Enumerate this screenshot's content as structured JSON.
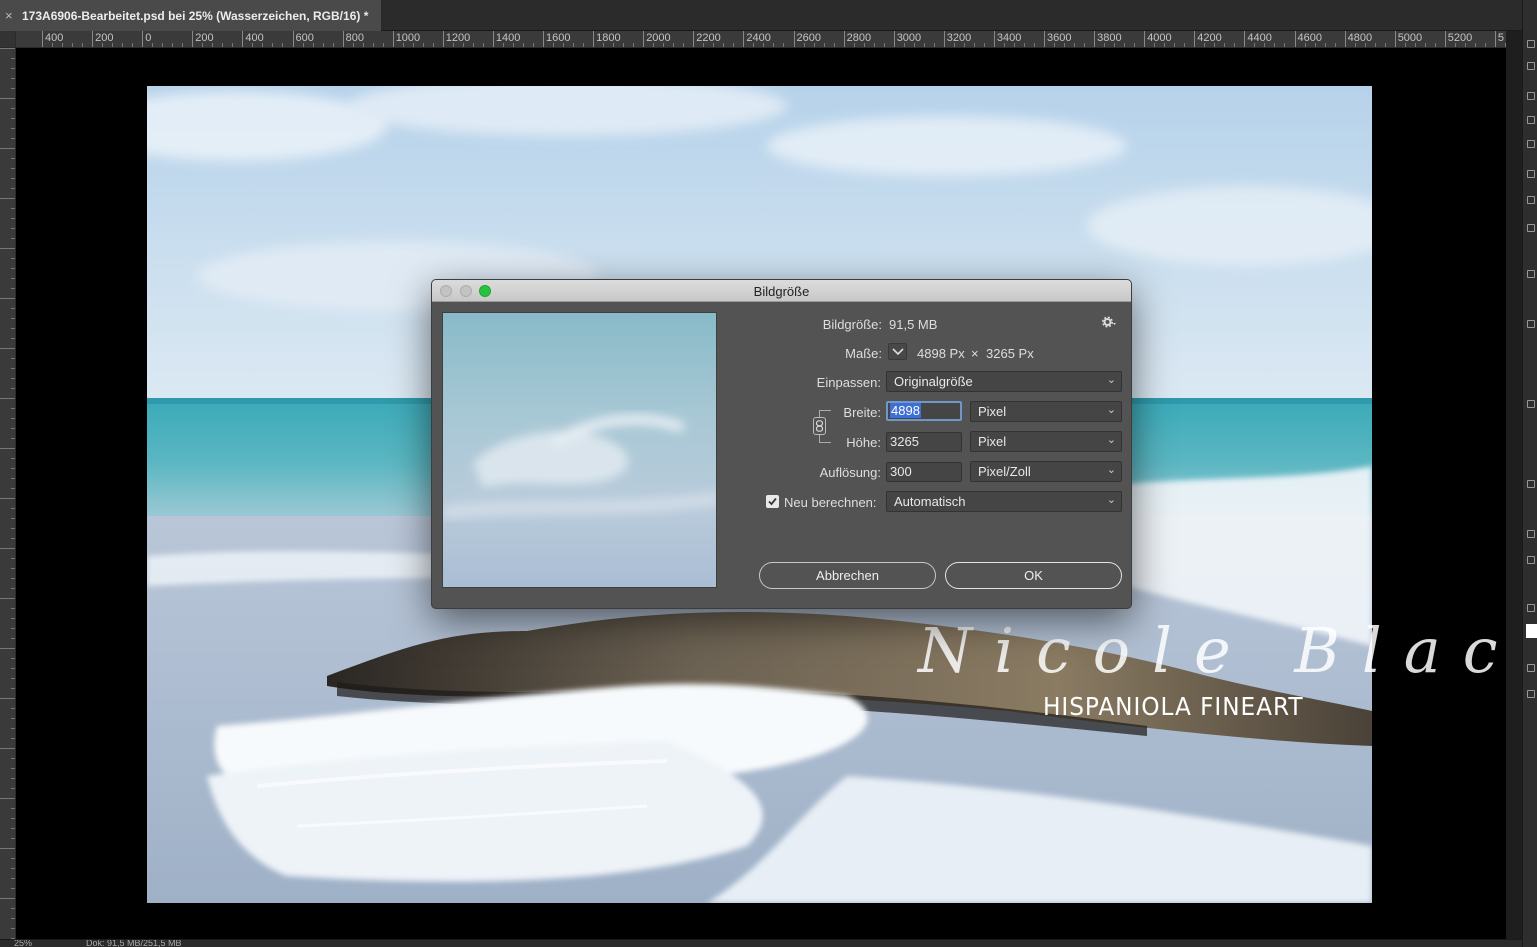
{
  "document_tab": {
    "close_glyph": "×",
    "title": "173A6906-Bearbeitet.psd bei 25% (Wasserzeichen, RGB/16) *"
  },
  "ruler": {
    "labels": [
      "400",
      "200",
      "0",
      "200",
      "400",
      "600",
      "800",
      "1000",
      "1200",
      "1400",
      "1600",
      "1800",
      "2000",
      "2200",
      "2400",
      "2600",
      "2800",
      "3000",
      "3200",
      "3400",
      "3600",
      "3800",
      "4000",
      "4200",
      "4400",
      "4600",
      "4800",
      "5000",
      "5200",
      "5"
    ]
  },
  "watermark": {
    "signature": "Nicole Black",
    "brand": "HISPANIOLA FINEART"
  },
  "status_bar": {
    "zoom": "25%",
    "doc_info": "Dok: 91,5 MB/251,5 MB"
  },
  "dialog": {
    "title": "Bildgröße",
    "image_size_label": "Bildgröße:",
    "image_size_value": "91,5 MB",
    "dimensions_label": "Maße:",
    "dimensions_width": "4898 Px",
    "dimensions_times": "×",
    "dimensions_height": "3265 Px",
    "fit_label": "Einpassen:",
    "fit_value": "Originalgröße",
    "width_label": "Breite:",
    "width_value": "4898",
    "width_unit": "Pixel",
    "height_label": "Höhe:",
    "height_value": "3265",
    "height_unit": "Pixel",
    "resolution_label": "Auflösung:",
    "resolution_value": "300",
    "resolution_unit": "Pixel/Zoll",
    "resample_label": "Neu berechnen:",
    "resample_checked": true,
    "resample_value": "Automatisch",
    "cancel_label": "Abbrechen",
    "ok_label": "OK",
    "gear_icon": "gear-icon",
    "chevron_icon": "chevron-down-icon",
    "link_icon": "chain-link-icon"
  },
  "colors": {
    "dialog_bg": "#535353",
    "accent_selection": "#3d6fd4",
    "focus_ring": "#6f97c9",
    "traffic_green": "#29c23e"
  }
}
